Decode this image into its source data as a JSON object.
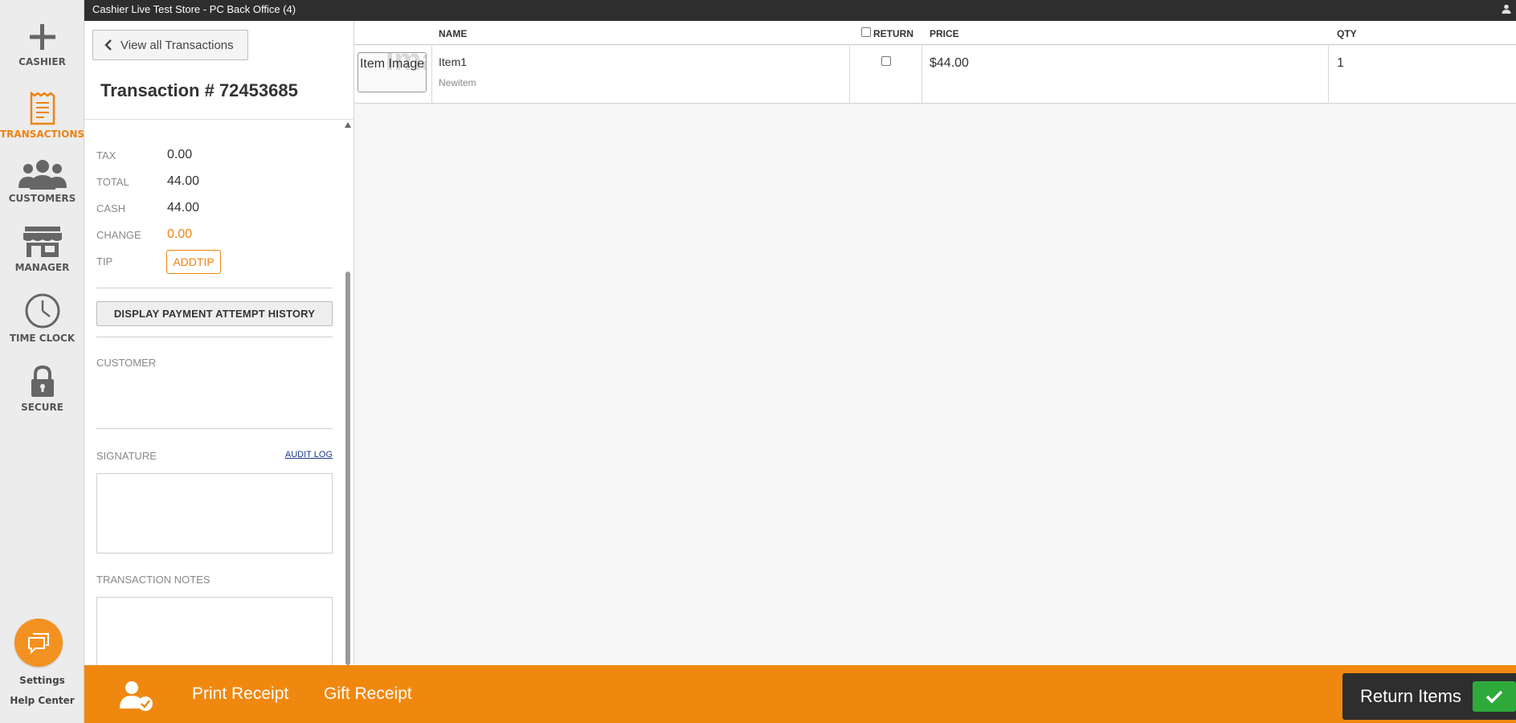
{
  "titlebar": {
    "title": "Cashier Live Test Store - PC Back Office (4)"
  },
  "nav": {
    "items": [
      {
        "label": "CASHIER",
        "icon": "plus-icon"
      },
      {
        "label": "TRANSACTIONS",
        "icon": "receipt-icon",
        "active": true
      },
      {
        "label": "CUSTOMERS",
        "icon": "people-icon"
      },
      {
        "label": "MANAGER",
        "icon": "store-icon"
      },
      {
        "label": "TIME CLOCK",
        "icon": "clock-icon"
      },
      {
        "label": "SECURE",
        "icon": "lock-icon"
      }
    ],
    "settings_label": "Settings",
    "help_label": "Help Center"
  },
  "panel": {
    "back_label": "View all Transactions",
    "txn_title": "Transaction # 72453685",
    "tax_label": "TAX",
    "tax_value": "0.00",
    "total_label": "TOTAL",
    "total_value": "44.00",
    "cash_label": "CASH",
    "cash_value": "44.00",
    "change_label": "CHANGE",
    "change_value": "0.00",
    "tip_label": "TIP",
    "tip_button": "ADDTIP",
    "payment_history_button": "DISPLAY PAYMENT ATTEMPT HISTORY",
    "customer_label": "CUSTOMER",
    "signature_label": "SIGNATURE",
    "audit_log_link": "AUDIT LOG",
    "notes_label": "TRANSACTION NOTES"
  },
  "table": {
    "headers": {
      "name": "NAME",
      "return": "RETURN",
      "price": "PRICE",
      "qty": "QTY"
    },
    "rows": [
      {
        "image_alt": "Item Image",
        "name": "Item1",
        "subtitle": "Newitem",
        "return_checked": false,
        "price": "$44.00",
        "qty": "1"
      }
    ]
  },
  "bottom": {
    "print_receipt": "Print Receipt",
    "gift_receipt": "Gift Receipt",
    "return_items": "Return Items"
  },
  "colors": {
    "accent": "#f0880f",
    "active_nav": "#ee8310",
    "confirm": "#2eaa3a",
    "titlebar": "#2e2e2e"
  }
}
